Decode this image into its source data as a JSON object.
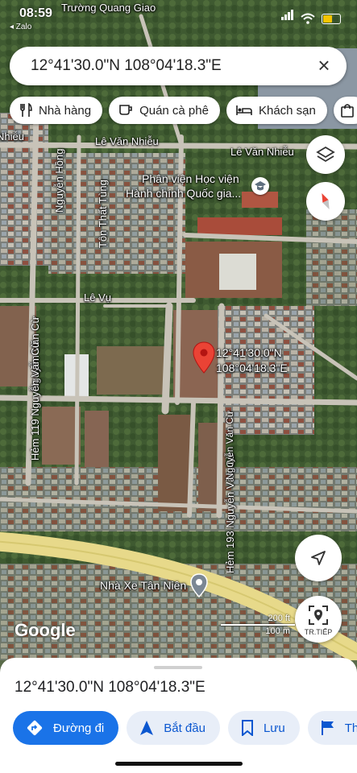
{
  "status": {
    "time": "08:59",
    "back_app": "◂ Zalo"
  },
  "search": {
    "value": "12°41'30.0\"N 108°04'18.3\"E",
    "close_icon": "close-icon"
  },
  "chips": [
    {
      "label": "Nhà hàng",
      "icon": "restaurant-icon"
    },
    {
      "label": "Quán cà phê",
      "icon": "coffee-icon"
    },
    {
      "label": "Khách sạn",
      "icon": "hotel-icon"
    },
    {
      "label": "",
      "icon": "shopping-bag-icon"
    }
  ],
  "map": {
    "street_labels": {
      "truong_quang_giao": "Trường Quang Giao",
      "le_van_nhieu_1": "Lê Văn Nhiễu",
      "le_van_nhieu_2": "Lê Văn Nhiễu",
      "nhieu_left": "Nhiễu",
      "nguyen_hong": "Nguyễn Hồng",
      "ton_that_tung": "Tôn Thất Tùng",
      "le_vu": "Lê Vụ",
      "nguyen_van_cu": "Nguyễn Văn Cừ",
      "hem_119": "Hẻm 119 Nguyễn Văn Cừ",
      "hem_193": "Hẻm 193 Nguyễn Văn Cừ",
      "nguyen_van_cu_short": "Nguyễn Văn Cừ"
    },
    "poi": {
      "line1": "Phân viện Học viện",
      "line2": "Hành chính Quốc gia..."
    },
    "pin_label": {
      "line1": "12°41'30.0\"N",
      "line2": "108°04'18.3\"E"
    },
    "bus_station": "Nhà Xe Tân Niên",
    "google_logo": "Google",
    "scale": {
      "top": "200 ft",
      "bottom": "100 m"
    },
    "street_view_label": "TR.TIẾP"
  },
  "sheet": {
    "title": "12°41'30.0\"N 108°04'18.3\"E",
    "actions": [
      {
        "label": "Đường đi",
        "icon": "directions-icon"
      },
      {
        "label": "Bắt đầu",
        "icon": "navigation-arrow-icon"
      },
      {
        "label": "Lưu",
        "icon": "bookmark-icon"
      },
      {
        "label": "Th",
        "icon": "flag-icon"
      }
    ]
  },
  "colors": {
    "accent": "#1a73e8",
    "pin": "#ea4335",
    "road": "#c8c3b8",
    "highway": "#e7d98a"
  }
}
